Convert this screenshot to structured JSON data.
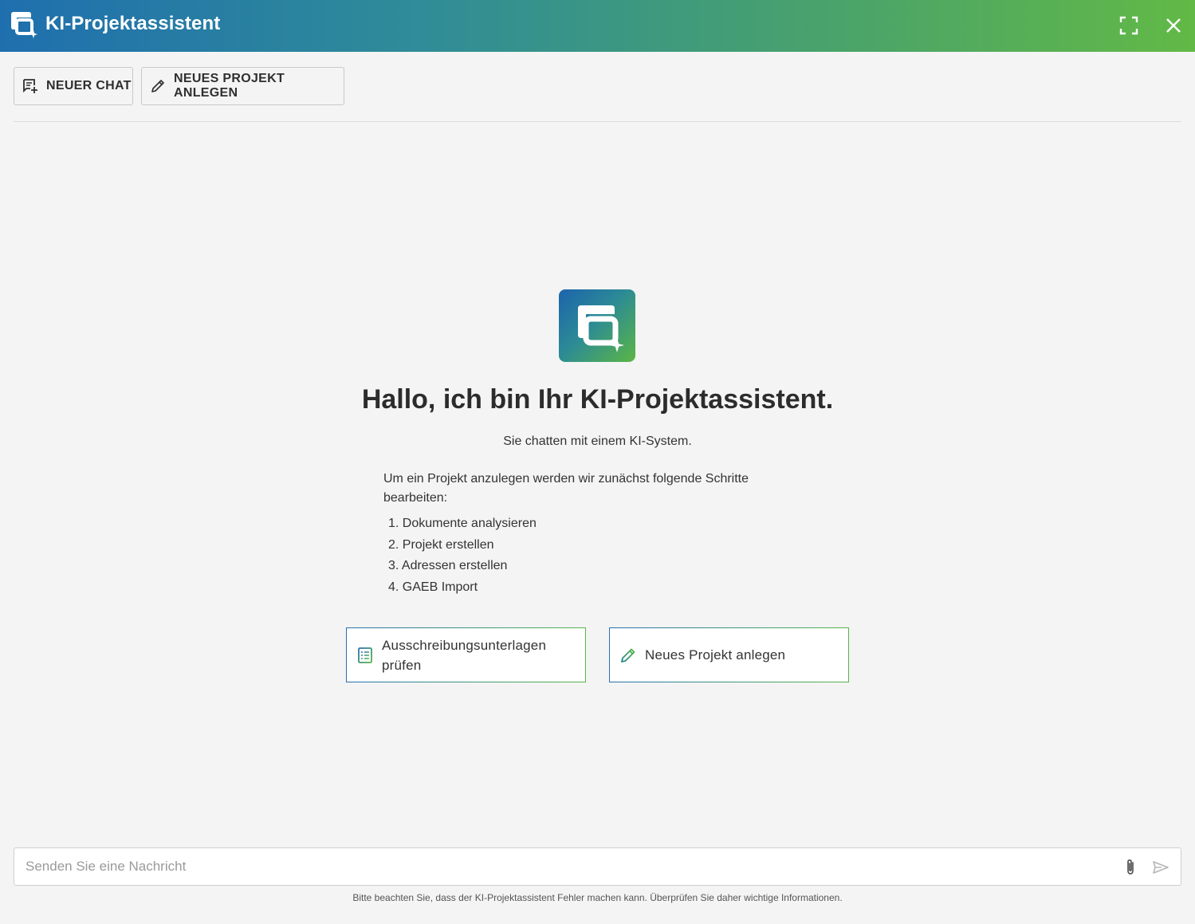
{
  "window": {
    "title": "KI-Projektassistent",
    "fullscreen_icon": "fullscreen-icon",
    "close_icon": "close-icon"
  },
  "toolbar": {
    "new_chat_label": "NEUER CHAT",
    "new_chat_icon": "new-chat-icon",
    "new_project_label": "NEUES PROJEKT ANLEGEN",
    "new_project_icon": "pencil-icon"
  },
  "welcome": {
    "title": "Hallo, ich bin Ihr KI-Projektassistent.",
    "subtitle": "Sie chatten mit einem KI-System.",
    "intro": "Um ein Projekt anzulegen werden wir zunächst folgende Schritte bearbeiten:",
    "steps": [
      "1. Dokumente analysieren",
      "2. Projekt erstellen",
      "3. Adressen erstellen",
      "4. GAEB Import"
    ]
  },
  "actions": [
    {
      "label": "Ausschreibungsunterlagen prüfen",
      "icon": "list-document-icon"
    },
    {
      "label": "Neues Projekt anlegen",
      "icon": "pencil-icon"
    }
  ],
  "composer": {
    "placeholder": "Senden Sie eine Nachricht",
    "value": "",
    "attach_icon": "paperclip-icon",
    "send_icon": "send-icon"
  },
  "disclaimer": "Bitte beachten Sie, dass der KI-Projektassistent Fehler machen kann. Überprüfen Sie daher wichtige Informationen.",
  "colors": {
    "gradient_start": "#1f6fae",
    "gradient_end": "#62b946",
    "background": "#f4f4f4"
  }
}
